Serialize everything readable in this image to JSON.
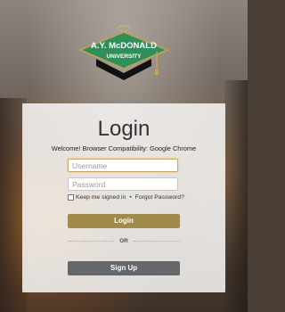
{
  "logo": {
    "name_line1": "A.Y. McDONALD",
    "name_line2": "UNIVERSITY",
    "icon": "graduation-cap-icon",
    "colors": {
      "green": "#2e8f5a",
      "gold": "#b8a05c",
      "black": "#111111"
    }
  },
  "login": {
    "title": "Login",
    "welcome": "Welcome! Browser Compatibility: Google Chrome",
    "username_placeholder": "Username",
    "password_placeholder": "Password",
    "remember_label": "Keep me signed in",
    "separator": "•",
    "forgot_label": "Forgot Password?",
    "login_button": "Login",
    "or_label": "OR",
    "signup_button": "Sign Up"
  },
  "colors": {
    "login_button": "#a08a4c",
    "signup_button": "#66676a",
    "focus_border": "#cba85a"
  }
}
